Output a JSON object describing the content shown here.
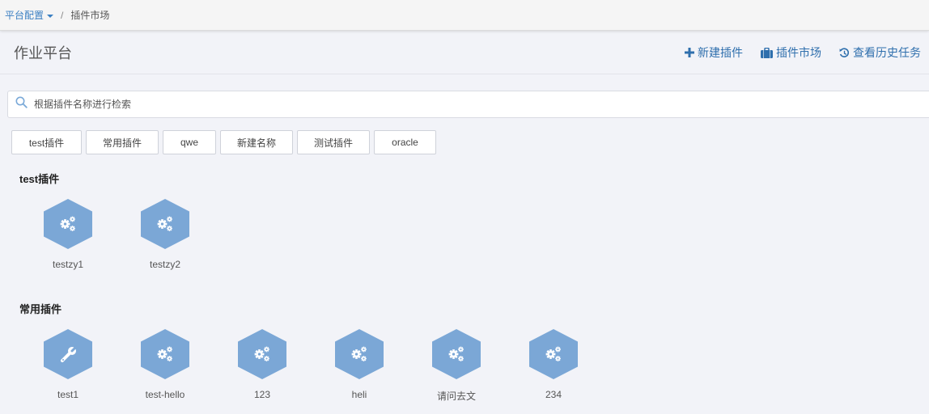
{
  "breadcrumb": {
    "parent": "平台配置",
    "separator": "/",
    "current": "插件市场"
  },
  "header": {
    "title": "作业平台",
    "actions": [
      {
        "label": "新建插件",
        "icon": "plus-icon"
      },
      {
        "label": "插件市场",
        "icon": "briefcase-icon"
      },
      {
        "label": "查看历史任务",
        "icon": "history-icon"
      }
    ]
  },
  "search": {
    "placeholder": "根据插件名称进行检索",
    "icon": "search-icon"
  },
  "tags": [
    "test插件",
    "常用插件",
    "qwe",
    "新建名称",
    "测试插件",
    "oracle"
  ],
  "sections": [
    {
      "title": "test插件",
      "plugins": [
        {
          "name": "testzy1",
          "icon": "gears-icon"
        },
        {
          "name": "testzy2",
          "icon": "gears-icon"
        }
      ]
    },
    {
      "title": "常用插件",
      "plugins": [
        {
          "name": "test1",
          "icon": "wrench-icon"
        },
        {
          "name": "test-hello",
          "icon": "gears-icon"
        },
        {
          "name": "123",
          "icon": "gears-icon"
        },
        {
          "name": "heli",
          "icon": "gears-icon"
        },
        {
          "name": "请问去文",
          "icon": "gears-icon"
        },
        {
          "name": "234",
          "icon": "gears-icon"
        }
      ]
    }
  ],
  "colors": {
    "accent": "#3a7fc2",
    "hexagon": "#7ba7d6",
    "background": "#f2f3f8"
  }
}
